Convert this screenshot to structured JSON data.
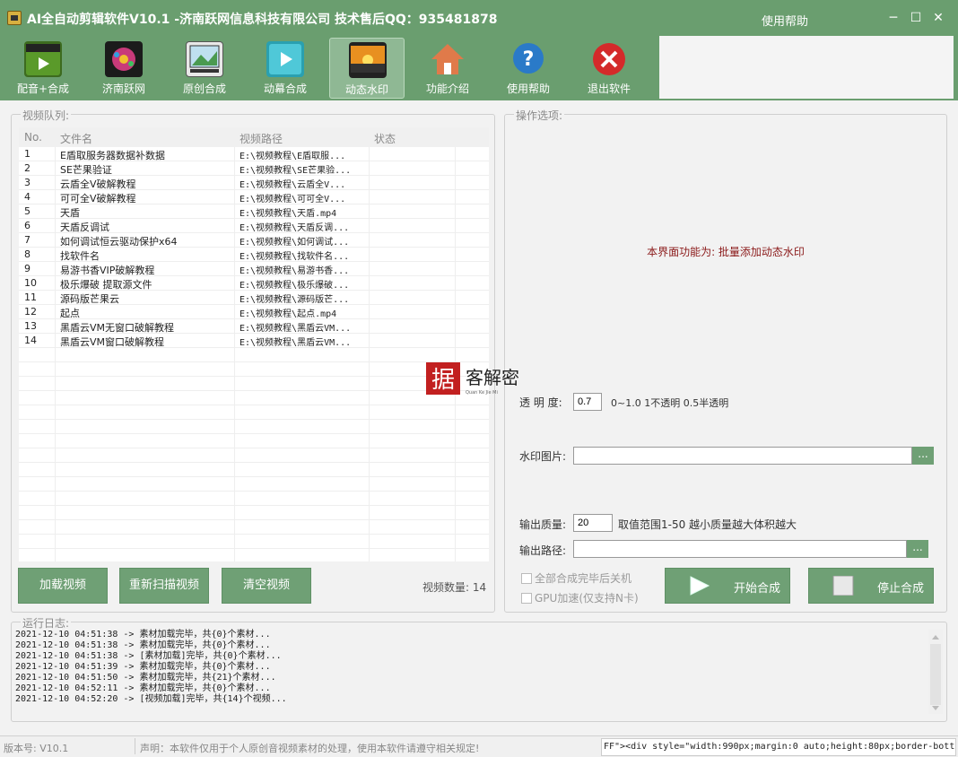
{
  "window": {
    "title": "AI全自动剪辑软件V10.1 -济南跃网信息科技有限公司 技术售后QQ：935481878",
    "help_link": "使用帮助",
    "minimize": "─",
    "maximize": "☐",
    "close": "✕"
  },
  "toolbar": {
    "items": [
      {
        "label": "配音+合成",
        "icon": "clapperboard-icon"
      },
      {
        "label": "济南跃网",
        "icon": "film-reel-icon"
      },
      {
        "label": "原创合成",
        "icon": "picture-edit-icon"
      },
      {
        "label": "动幕合成",
        "icon": "play-video-icon"
      },
      {
        "label": "动态水印",
        "icon": "sunset-photo-icon"
      },
      {
        "label": "功能介绍",
        "icon": "home-icon"
      },
      {
        "label": "使用帮助",
        "icon": "help-icon"
      },
      {
        "label": "退出软件",
        "icon": "exit-icon"
      }
    ],
    "active_index": 4
  },
  "queue": {
    "title": "视频队列:",
    "columns": {
      "no": "No.",
      "name": "文件名",
      "path": "视频路径",
      "status": "状态"
    },
    "rows": [
      {
        "no": "1",
        "name": "E盾取服务器数据补数据",
        "path": "E:\\视频教程\\E盾取服...",
        "status": ""
      },
      {
        "no": "2",
        "name": "SE芒果验证",
        "path": "E:\\视频教程\\SE芒果验...",
        "status": ""
      },
      {
        "no": "3",
        "name": "云盾全V破解教程",
        "path": "E:\\视频教程\\云盾全V...",
        "status": ""
      },
      {
        "no": "4",
        "name": "可可全V破解教程",
        "path": "E:\\视频教程\\可可全V...",
        "status": ""
      },
      {
        "no": "5",
        "name": "天盾",
        "path": "E:\\视频教程\\天盾.mp4",
        "status": ""
      },
      {
        "no": "6",
        "name": "天盾反调试",
        "path": "E:\\视频教程\\天盾反调...",
        "status": ""
      },
      {
        "no": "7",
        "name": "如何调试恒云驱动保护x64",
        "path": "E:\\视频教程\\如何调试...",
        "status": ""
      },
      {
        "no": "8",
        "name": "找软件名",
        "path": "E:\\视频教程\\找软件名...",
        "status": ""
      },
      {
        "no": "9",
        "name": "易游书香VIP破解教程",
        "path": "E:\\视频教程\\易游书香...",
        "status": ""
      },
      {
        "no": "10",
        "name": "极乐爆破 提取源文件",
        "path": "E:\\视频教程\\极乐爆破...",
        "status": ""
      },
      {
        "no": "11",
        "name": "源码版芒果云",
        "path": "E:\\视频教程\\源码版芒...",
        "status": ""
      },
      {
        "no": "12",
        "name": "起点",
        "path": "E:\\视频教程\\起点.mp4",
        "status": ""
      },
      {
        "no": "13",
        "name": "黑盾云VM无窗口破解教程",
        "path": "E:\\视频教程\\黑盾云VM...",
        "status": ""
      },
      {
        "no": "14",
        "name": "黑盾云VM窗口破解教程",
        "path": "E:\\视频教程\\黑盾云VM...",
        "status": ""
      }
    ],
    "buttons": {
      "load": "加载视频",
      "rescan": "重新扫描视频",
      "clear": "清空视频"
    },
    "count_label": "视频数量: 14"
  },
  "options": {
    "title": "操作选项:",
    "function_desc": "本界面功能为: 批量添加动态水印",
    "opacity_label": "透 明 度:",
    "opacity_value": "0.7",
    "opacity_hint": "0~1.0 1不透明 0.5半透明",
    "image_label": "水印图片:",
    "image_value": "",
    "browse": "...",
    "quality_label": "输出质量:",
    "quality_value": "20",
    "quality_hint": "取值范围1-50 越小质量越大体积越大",
    "output_label": "输出路径:",
    "output_value": "",
    "shutdown_label": "全部合成完毕后关机",
    "gpu_label": "GPU加速(仅支持N卡)",
    "start_button": "开始合成",
    "stop_button": "停止合成"
  },
  "log": {
    "title": "运行日志:",
    "lines": [
      "2021-12-10 04:51:38 -> 素材加载完毕，共{0}个素材...",
      "2021-12-10 04:51:38 -> 素材加载完毕，共{0}个素材...",
      "2021-12-10 04:51:38 -> [素材加载]完毕，共{0}个素材...",
      "2021-12-10 04:51:39 -> 素材加载完毕，共{0}个素材...",
      "2021-12-10 04:51:50 -> 素材加载完毕，共{21}个素材...",
      "2021-12-10 04:52:11 -> 素材加载完毕，共{0}个素材...",
      "2021-12-10 04:52:20 -> [视频加载]完毕，共{14}个视频..."
    ]
  },
  "status": {
    "version": "版本号: V10.1",
    "disclaimer": "声明：本软件仅用于个人原创音视频素材的处理，使用本软件请遵守相关规定!",
    "code_text": "FF\"><div style=\"width:990px;margin:0 auto;height:80px;border-bott"
  },
  "watermark": {
    "text": "据 客解密",
    "sub": "Quan Ke Jie Mi"
  },
  "colors": {
    "theme_green": "#6a9e6f",
    "button_green": "#6fa075",
    "desc_red": "#8b1a1a"
  }
}
